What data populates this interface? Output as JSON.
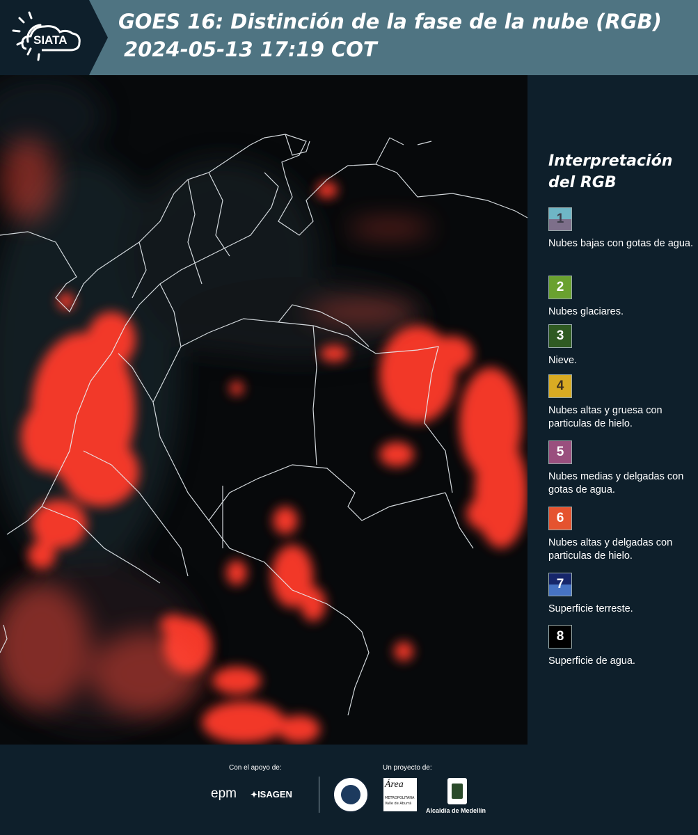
{
  "header": {
    "logo_text": "SIATA",
    "title_line1": "GOES 16: Distinción de la fase de la nube (RGB)",
    "title_line2": "2024-05-13 17:19 COT"
  },
  "legend": {
    "title_line1": "Interpretación",
    "title_line2": "del RGB",
    "items": [
      {
        "num": "1",
        "label": "Nubes bajas con gotas de agua.",
        "colors": [
          "#6fb6c6",
          "#7d6f8a"
        ],
        "text_color": "#3d3d4a"
      },
      {
        "num": "2",
        "label": "Nubes glaciares.",
        "colors": [
          "#6aa12f"
        ],
        "text_color": "#ffffff"
      },
      {
        "num": "3",
        "label": "Nieve.",
        "colors": [
          "#2f5a22"
        ],
        "text_color": "#ffffff"
      },
      {
        "num": "4",
        "label": "Nubes altas y gruesa con particulas de hielo.",
        "colors": [
          "#d9ab23"
        ],
        "text_color": "#3d3020"
      },
      {
        "num": "5",
        "label": "Nubes medias y delgadas con gotas de agua.",
        "colors": [
          "#9a4f7e"
        ],
        "text_color": "#ffffff"
      },
      {
        "num": "6",
        "label": "Nubes altas y delgadas con particulas de hielo.",
        "colors": [
          "#e5532f"
        ],
        "text_color": "#ffffff"
      },
      {
        "num": "7",
        "label": "Superficie terreste.",
        "colors": [
          "#16266a",
          "#4673c4"
        ],
        "text_color": "#ffffff"
      },
      {
        "num": "8",
        "label": "Superficie de agua.",
        "colors": [
          "#000000"
        ],
        "text_color": "#ffffff"
      }
    ]
  },
  "footer": {
    "support_label": "Con el apoyo de:",
    "project_label": "Un proyecto de:",
    "brand_epm": "epm",
    "brand_isagen": "ISAGEN",
    "brand_area_line1": "METROPOLITANA",
    "brand_area_line2": "Valle de Aburrá",
    "brand_alcaldia": "Alcaldía de Medellín"
  },
  "colors": {
    "header_bg": "#4f7482",
    "logo_bg": "#0e1f2b",
    "panel_bg": "#0e1f2b",
    "cloud_red": "#ff3a2a"
  }
}
